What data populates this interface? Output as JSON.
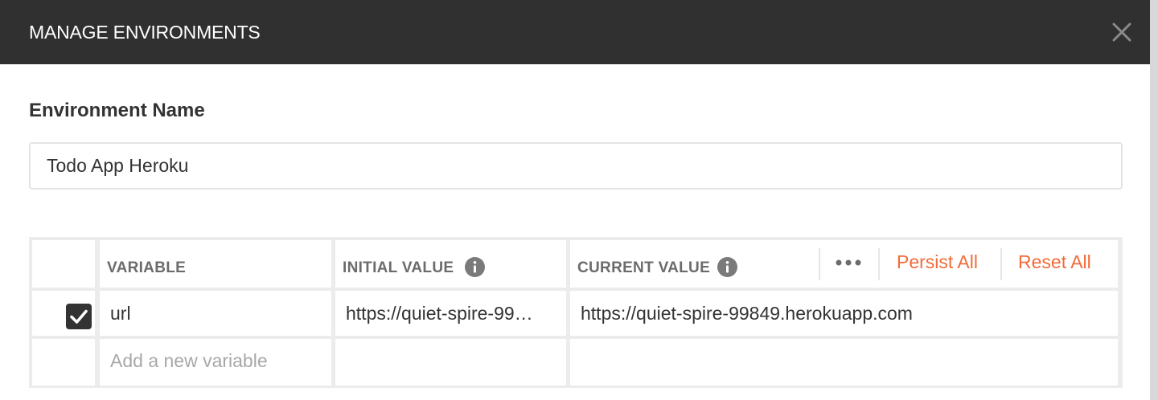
{
  "modal": {
    "title": "MANAGE ENVIRONMENTS",
    "close_icon": "close-icon"
  },
  "environment": {
    "name_label": "Environment Name",
    "name_value": "Todo App Heroku"
  },
  "table": {
    "headers": {
      "variable": "VARIABLE",
      "initial_value": "INITIAL VALUE",
      "current_value": "CURRENT VALUE"
    },
    "info_icon": "info-icon",
    "more_icon": "more-options-icon",
    "persist_all": "Persist All",
    "reset_all": "Reset All",
    "rows": [
      {
        "checked": true,
        "variable": "url",
        "initial_value": "https://quiet-spire-99…",
        "current_value": "https://quiet-spire-99849.herokuapp.com"
      }
    ],
    "new_variable_placeholder": "Add a new variable"
  },
  "colors": {
    "header_bg": "#303030",
    "accent": "#f26b3a",
    "checkbox": "#333333",
    "grid": "#ececec"
  }
}
